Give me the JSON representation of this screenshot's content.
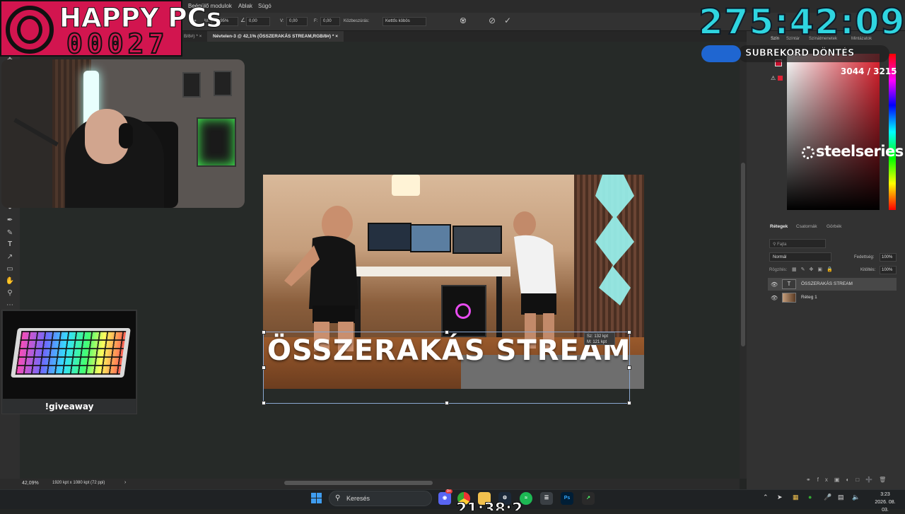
{
  "photoshop": {
    "menu": [
      "Beépülő modulok",
      "Ablak",
      "Súgó"
    ],
    "options": {
      "w_label": "M:",
      "w_value": "89,95%",
      "angle_value": "0,00",
      "v_label": "V:",
      "v_value": "0,00",
      "f_label": "F:",
      "f_value": "0,00",
      "interp_label": "Közbeszúrás:",
      "interp_value": "Kettős köbös"
    },
    "tabs": {
      "prev_fragment": "B/8#) *",
      "active": "Névtelen-3 @ 42,1% (ÖSSZERAKÁS STREAM,RGB/8#) *"
    },
    "canvas": {
      "title_text": "ÖSSZERAKÁS STREAM",
      "size_tip_line1": "Sz: 132 kpt",
      "size_tip_line2": "M: 121 kpt"
    },
    "status": {
      "zoom": "42,09%",
      "doc_size": "1920 kpt x 1080 kpt (72 ppi)"
    },
    "color_tabs": [
      "Szín",
      "Színtár",
      "Színátmenetek",
      "Mintázatok"
    ],
    "layers": {
      "tabs": [
        "Rétegek",
        "Csatornák",
        "Görbék"
      ],
      "search_placeholder": "Fajta",
      "blend_mode": "Normál",
      "opacity_label": "Fedettség:",
      "opacity_value": "100%",
      "lock_label": "Rögzítés:",
      "fill_label": "Kitöltés:",
      "fill_value": "100%",
      "items": [
        {
          "name": "ÖSSZERAKÁS STREAM",
          "thumb": "T"
        },
        {
          "name": "Réteg 1",
          "thumb": ""
        }
      ]
    }
  },
  "overlay": {
    "logo_title": "HAPPY PCs",
    "logo_number": "00027",
    "timer": "275:42:09",
    "sub_label": "SUBREKORD DÖNTÉS",
    "sub_count": "3044 / 3215",
    "sponsor": "steelseries",
    "giveaway": "!giveaway",
    "bottom_ticker": "21:38:2"
  },
  "taskbar": {
    "search_label": "Keresés",
    "discord_badge": "9+",
    "time": "3:23",
    "date": "2026. 08. 03."
  }
}
